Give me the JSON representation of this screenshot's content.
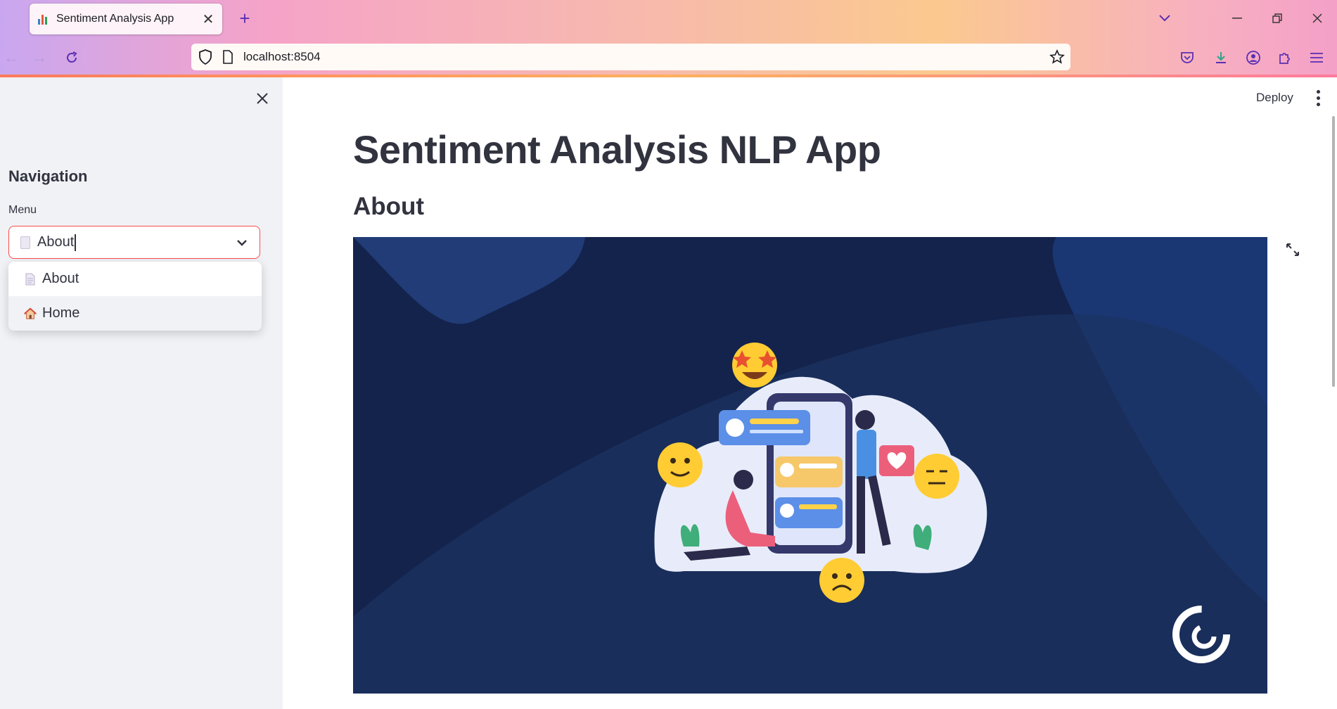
{
  "browser": {
    "tab_title": "Sentiment Analysis App",
    "url": "localhost:8504"
  },
  "sidebar": {
    "heading": "Navigation",
    "menu_label": "Menu",
    "selected_value": "About",
    "options": [
      {
        "label": "About",
        "icon": "page-icon"
      },
      {
        "label": "Home",
        "icon": "house-icon"
      }
    ]
  },
  "header": {
    "deploy_label": "Deploy"
  },
  "main": {
    "title": "Sentiment Analysis NLP App",
    "subheader": "About"
  },
  "colors": {
    "accent": "#ff4b4b",
    "text": "#31333f",
    "sidebar_bg": "#f0f2f6",
    "hero_bg": "#14244f"
  }
}
